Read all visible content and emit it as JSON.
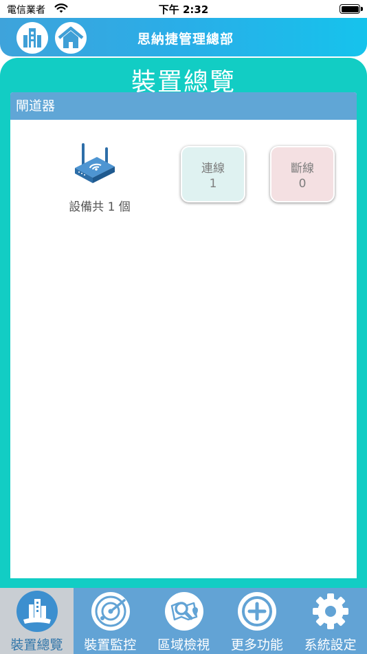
{
  "status_bar": {
    "carrier": "電信業者",
    "time": "下午 2:32"
  },
  "header": {
    "title": "思納捷管理總部",
    "icons": [
      "building-icon",
      "home-icon"
    ]
  },
  "page": {
    "title": "裝置總覽"
  },
  "section": {
    "title": "閘道器",
    "device_count": "設備共 1 個",
    "online": {
      "label": "連線",
      "value": "1"
    },
    "offline": {
      "label": "斷線",
      "value": "0"
    }
  },
  "tabs": [
    {
      "label": "裝置總覽",
      "icon": "overview-icon",
      "active": true
    },
    {
      "label": "裝置監控",
      "icon": "radar-icon",
      "active": false
    },
    {
      "label": "區域檢視",
      "icon": "map-search-icon",
      "active": false
    },
    {
      "label": "更多功能",
      "icon": "plus-icon",
      "active": false
    },
    {
      "label": "系統設定",
      "icon": "gear-icon",
      "active": false
    }
  ],
  "colors": {
    "header_blue": "#29aee8",
    "teal": "#12cdc4",
    "section_head": "#60a6d6",
    "tab_bar": "#62a3d5",
    "online_bg": "#dff2f1",
    "offline_bg": "#f4e0e2"
  }
}
